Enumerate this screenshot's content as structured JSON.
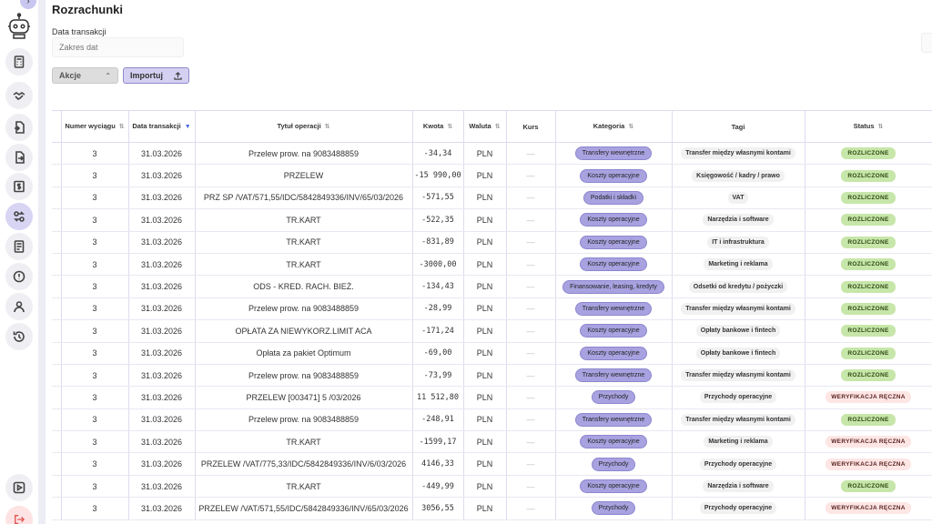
{
  "page": {
    "title": "Rozrachunki"
  },
  "filter": {
    "label": "Data transakcji",
    "placeholder": "Zakres dat"
  },
  "toolbar": {
    "actions_label": "Akcje",
    "import_label": "Importuj"
  },
  "sidebar": {
    "expand_icon": "chevron-right-icon",
    "items": [
      {
        "icon": "calculator-icon"
      },
      {
        "icon": "handshake-icon"
      },
      {
        "icon": "file-import-icon"
      },
      {
        "icon": "file-export-icon"
      },
      {
        "icon": "dollar-icon"
      },
      {
        "icon": "transfer-icon",
        "active": true
      },
      {
        "icon": "report-icon"
      },
      {
        "icon": "alert-icon"
      },
      {
        "icon": "user-icon"
      },
      {
        "icon": "history-icon"
      },
      {
        "icon": "play-icon"
      }
    ],
    "logout_icon": "logout-icon"
  },
  "table": {
    "columns": [
      {
        "key": "",
        "label": ""
      },
      {
        "key": "numer",
        "label": "Numer wyciągu",
        "sortable": true
      },
      {
        "key": "data",
        "label": "Data transakcji",
        "sortable": true,
        "sort_active": true
      },
      {
        "key": "tytul",
        "label": "Tytuł operacji",
        "sortable": true
      },
      {
        "key": "kwota",
        "label": "Kwota",
        "sortable": true
      },
      {
        "key": "waluta",
        "label": "Waluta",
        "sortable": true
      },
      {
        "key": "kurs",
        "label": "Kurs",
        "sortable": false
      },
      {
        "key": "kategoria",
        "label": "Kategoria",
        "sortable": true
      },
      {
        "key": "tagi",
        "label": "Tagi",
        "sortable": false
      },
      {
        "key": "status",
        "label": "Status",
        "sortable": true
      }
    ],
    "rows": [
      {
        "numer": "3",
        "data": "31.03.2026",
        "tytul": "Przelew prow. na 9083488859",
        "kwota": "-34,34",
        "waluta": "PLN",
        "kurs": "—",
        "kategoria": "Transfery wewnętrzne",
        "tag": "Transfer między własnymi kontami",
        "status": "ROZLICZONE",
        "status_type": "ok"
      },
      {
        "numer": "3",
        "data": "31.03.2026",
        "tytul": "PRZELEW",
        "kwota": "-15 990,00",
        "waluta": "PLN",
        "kurs": "—",
        "kategoria": "Koszty operacyjne",
        "tag": "Księgowość / kadry / prawo",
        "status": "ROZLICZONE",
        "status_type": "ok"
      },
      {
        "numer": "3",
        "data": "31.03.2026",
        "tytul": "PRZ SP /VAT/571,55/IDC/5842849336/INV/65/03/2026",
        "kwota": "-571,55",
        "waluta": "PLN",
        "kurs": "—",
        "kategoria": "Podatki i składki",
        "tag": "VAT",
        "status": "ROZLICZONE",
        "status_type": "ok"
      },
      {
        "numer": "3",
        "data": "31.03.2026",
        "tytul": "TR.KART",
        "kwota": "-522,35",
        "waluta": "PLN",
        "kurs": "—",
        "kategoria": "Koszty operacyjne",
        "tag": "Narzędzia i software",
        "status": "ROZLICZONE",
        "status_type": "ok"
      },
      {
        "numer": "3",
        "data": "31.03.2026",
        "tytul": "TR.KART",
        "kwota": "-831,89",
        "waluta": "PLN",
        "kurs": "—",
        "kategoria": "Koszty operacyjne",
        "tag": "IT i infrastruktura",
        "status": "ROZLICZONE",
        "status_type": "ok"
      },
      {
        "numer": "3",
        "data": "31.03.2026",
        "tytul": "TR.KART",
        "kwota": "-3000,00",
        "waluta": "PLN",
        "kurs": "—",
        "kategoria": "Koszty operacyjne",
        "tag": "Marketing i reklama",
        "status": "ROZLICZONE",
        "status_type": "ok"
      },
      {
        "numer": "3",
        "data": "31.03.2026",
        "tytul": "ODS - KRED. RACH. BIEŻ.",
        "kwota": "-134,43",
        "waluta": "PLN",
        "kurs": "—",
        "kategoria": "Finansowanie, leasing, kredyty",
        "tag": "Odsetki od kredytu / pożyczki",
        "status": "ROZLICZONE",
        "status_type": "ok"
      },
      {
        "numer": "3",
        "data": "31.03.2026",
        "tytul": "Przelew prow. na 9083488859",
        "kwota": "-28,99",
        "waluta": "PLN",
        "kurs": "—",
        "kategoria": "Transfery wewnętrzne",
        "tag": "Transfer między własnymi kontami",
        "status": "ROZLICZONE",
        "status_type": "ok"
      },
      {
        "numer": "3",
        "data": "31.03.2026",
        "tytul": "OPŁATA ZA NIEWYKORZ.LIMIT ACA",
        "kwota": "-171,24",
        "waluta": "PLN",
        "kurs": "—",
        "kategoria": "Koszty operacyjne",
        "tag": "Opłaty bankowe i fintech",
        "status": "ROZLICZONE",
        "status_type": "ok"
      },
      {
        "numer": "3",
        "data": "31.03.2026",
        "tytul": "Opłata za pakiet Optimum",
        "kwota": "-69,00",
        "waluta": "PLN",
        "kurs": "—",
        "kategoria": "Koszty operacyjne",
        "tag": "Opłaty bankowe i fintech",
        "status": "ROZLICZONE",
        "status_type": "ok"
      },
      {
        "numer": "3",
        "data": "31.03.2026",
        "tytul": "Przelew prow. na 9083488859",
        "kwota": "-73,99",
        "waluta": "PLN",
        "kurs": "—",
        "kategoria": "Transfery wewnętrzne",
        "tag": "Transfer między własnymi kontami",
        "status": "ROZLICZONE",
        "status_type": "ok"
      },
      {
        "numer": "3",
        "data": "31.03.2026",
        "tytul": "PRZELEW [003471] 5 /03/2026",
        "kwota": "11 512,80",
        "waluta": "PLN",
        "kurs": "—",
        "kategoria": "Przychody",
        "tag": "Przychody operacyjne",
        "status": "WERYFIKACJA RĘCZNA",
        "status_type": "warn"
      },
      {
        "numer": "3",
        "data": "31.03.2026",
        "tytul": "Przelew prow. na 9083488859",
        "kwota": "-248,91",
        "waluta": "PLN",
        "kurs": "—",
        "kategoria": "Transfery wewnętrzne",
        "tag": "Transfer między własnymi kontami",
        "status": "ROZLICZONE",
        "status_type": "ok"
      },
      {
        "numer": "3",
        "data": "31.03.2026",
        "tytul": "TR.KART",
        "kwota": "-1599,17",
        "waluta": "PLN",
        "kurs": "—",
        "kategoria": "Koszty operacyjne",
        "tag": "Marketing i reklama",
        "status": "WERYFIKACJA RĘCZNA",
        "status_type": "warn"
      },
      {
        "numer": "3",
        "data": "31.03.2026",
        "tytul": "PRZELEW /VAT/775,33/IDC/5842849336/INV/6/03/2026",
        "kwota": "4146,33",
        "waluta": "PLN",
        "kurs": "—",
        "kategoria": "Przychody",
        "tag": "Przychody operacyjne",
        "status": "WERYFIKACJA RĘCZNA",
        "status_type": "warn"
      },
      {
        "numer": "3",
        "data": "31.03.2026",
        "tytul": "TR.KART",
        "kwota": "-449,99",
        "waluta": "PLN",
        "kurs": "—",
        "kategoria": "Koszty operacyjne",
        "tag": "Narzędzia i software",
        "status": "ROZLICZONE",
        "status_type": "ok"
      },
      {
        "numer": "3",
        "data": "31.03.2026",
        "tytul": "PRZELEW /VAT/571,55/IDC/5842849336/INV/65/03/2026",
        "kwota": "3056,55",
        "waluta": "PLN",
        "kurs": "—",
        "kategoria": "Przychody",
        "tag": "Przychody operacyjne",
        "status": "WERYFIKACJA RĘCZNA",
        "status_type": "warn"
      }
    ]
  }
}
